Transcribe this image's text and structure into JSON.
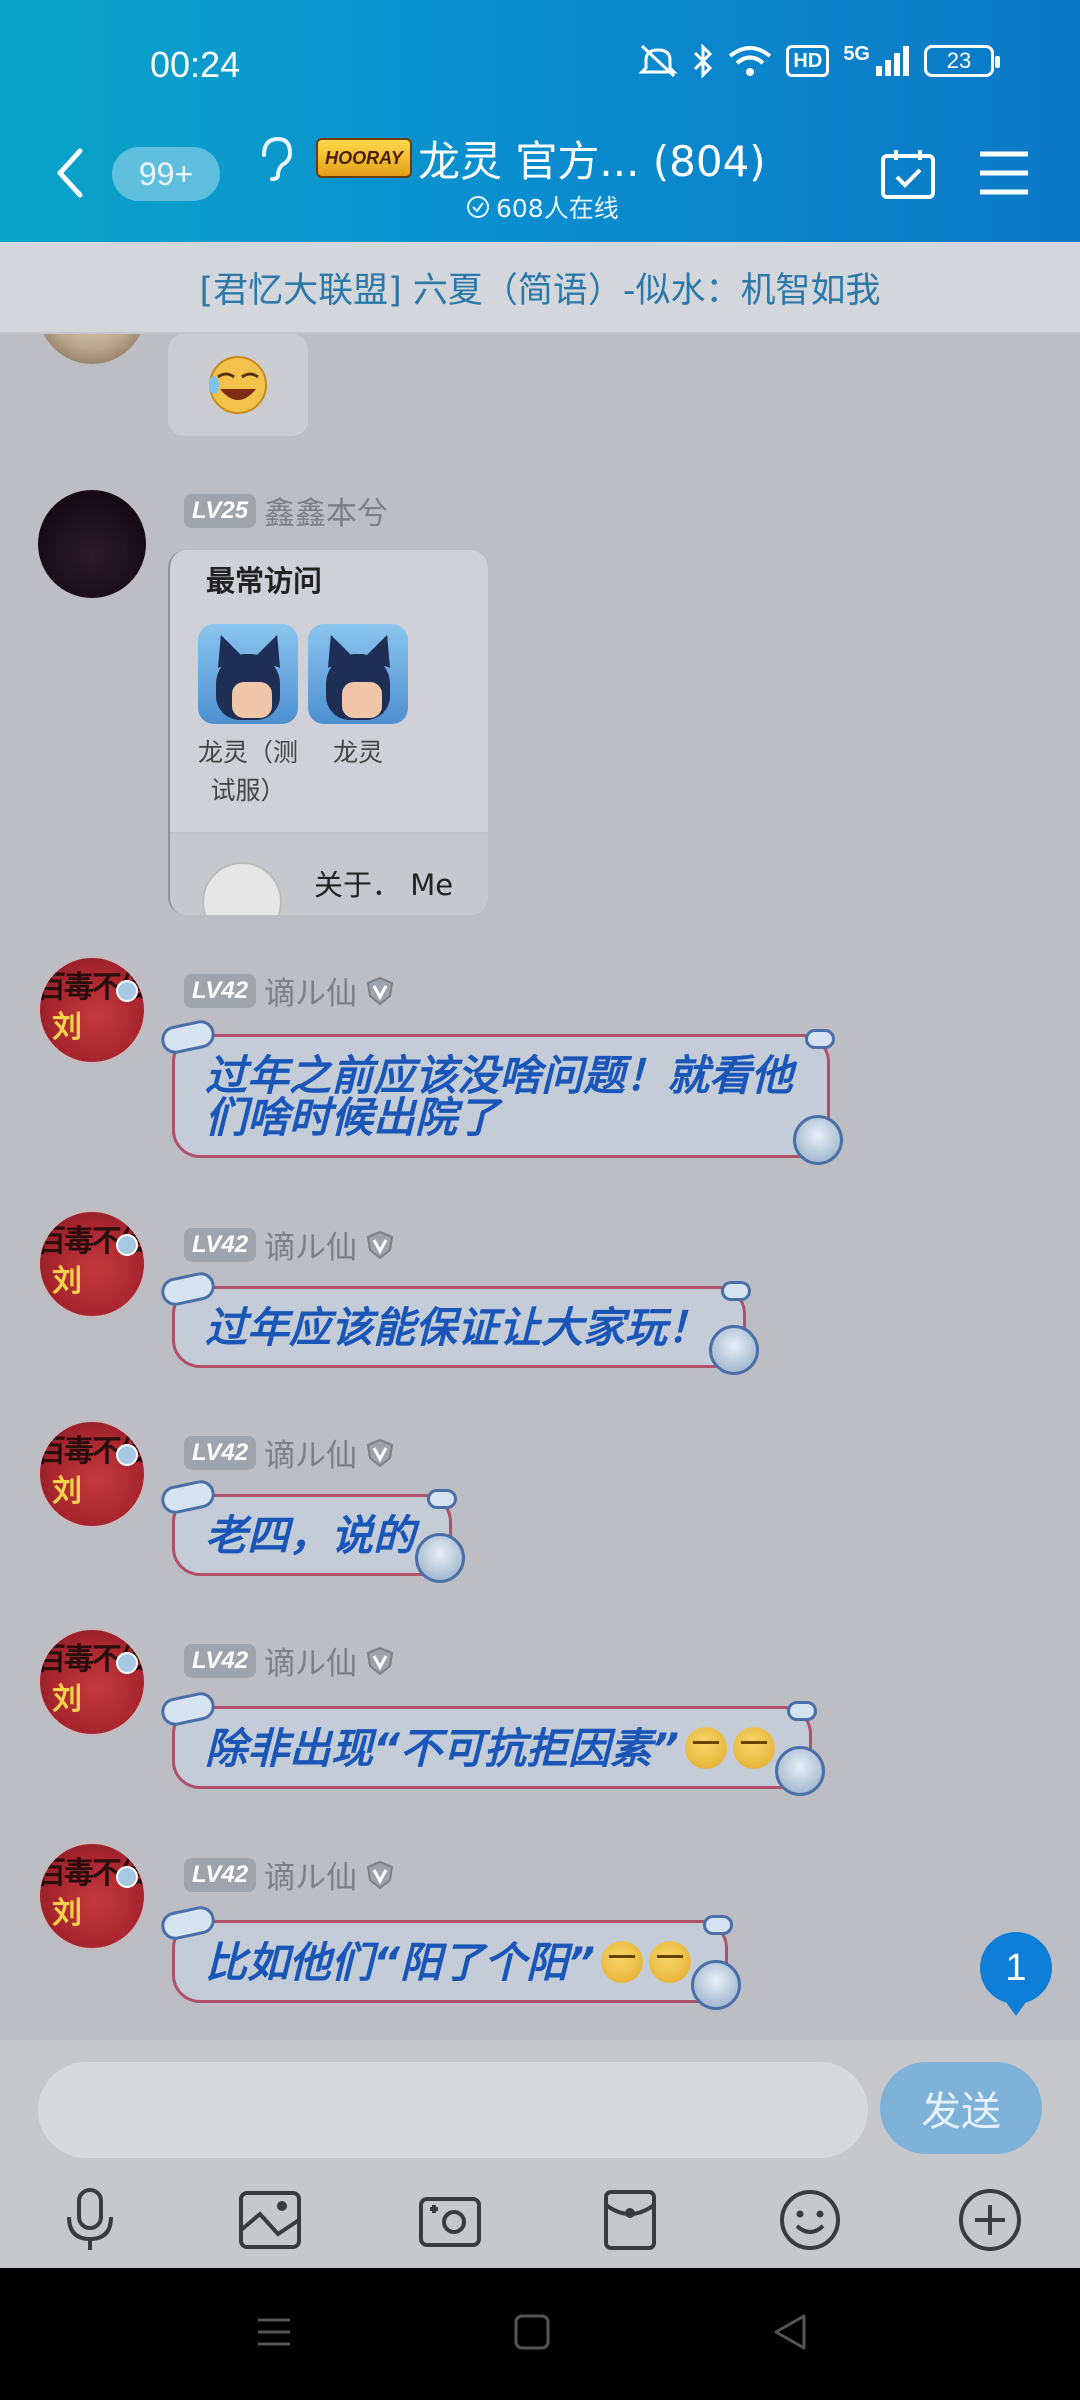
{
  "status": {
    "time": "00:24",
    "network": "5G",
    "hd": "HD",
    "battery": "23"
  },
  "header": {
    "unread": "99+",
    "group_logo_text": "HOORAY",
    "group_title": "龙灵 官方... (804)",
    "online": "608人在线"
  },
  "notice": "[君忆大联盟] 六夏（简语）-似水：机智如我",
  "messages": {
    "m2": {
      "level": "LV25",
      "sender": "鑫鑫本兮",
      "card_title": "最常访问",
      "app1": "龙灵（测试服）",
      "app2": "龙灵",
      "footer": "关于． Me"
    },
    "m3": {
      "level": "LV42",
      "sender": "谪ル仙",
      "line1": "过年之前应该没啥问题！就看他",
      "line2": "们啥时候出院了"
    },
    "m4": {
      "level": "LV42",
      "sender": "谪ル仙",
      "text": "过年应该能保证让大家玩！"
    },
    "m5": {
      "level": "LV42",
      "sender": "谪ル仙",
      "text": "老四，说的"
    },
    "m6": {
      "level": "LV42",
      "sender": "谪ル仙",
      "text": "除非出现“不可抗拒因素”"
    },
    "m7": {
      "level": "LV42",
      "sender": "谪ル仙",
      "text": "比如他们“阳了个阳”"
    }
  },
  "avatar_texts": {
    "line1": "百毒不侵",
    "line2": "刘"
  },
  "jump_badge": "1",
  "input": {
    "placeholder": "",
    "send_label": "发送"
  },
  "colors": {
    "header_start": "#0aa4c9",
    "header_end": "#0b78c6",
    "bubble_text": "#1a56b8",
    "badge": "#0e7ed7"
  }
}
